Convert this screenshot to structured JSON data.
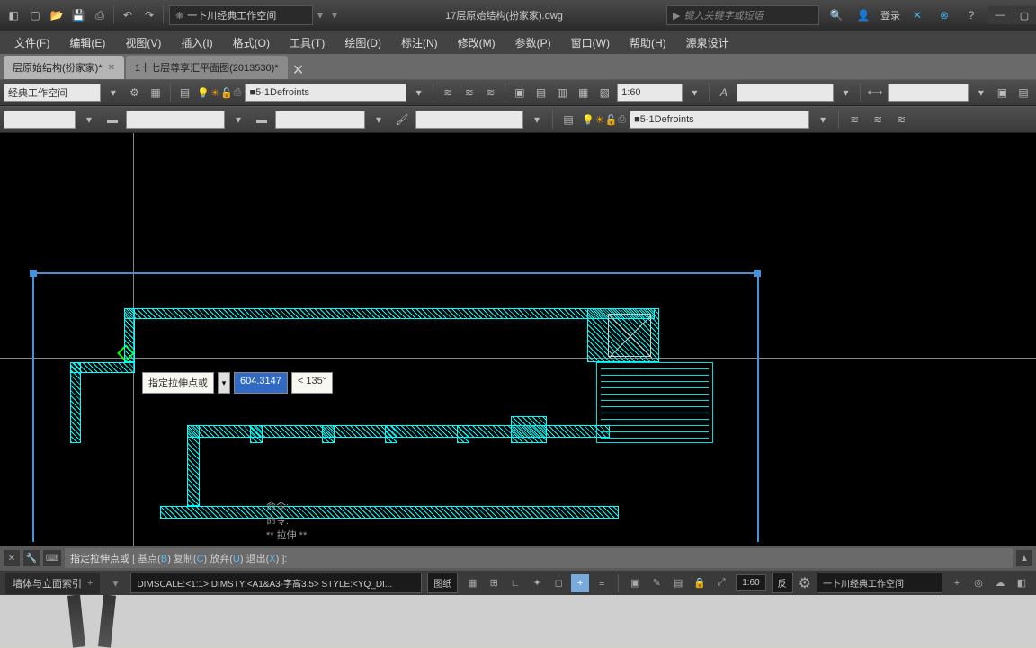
{
  "titlebar": {
    "workspace": "一卜川经典工作空间",
    "filename": "17层原始结构(扮家家).dwg",
    "searchPlaceholder": "键入关键字或短语",
    "login": "登录"
  },
  "menus": [
    "文件(F)",
    "编辑(E)",
    "视图(V)",
    "插入(I)",
    "格式(O)",
    "工具(T)",
    "绘图(D)",
    "标注(N)",
    "修改(M)",
    "参数(P)",
    "窗口(W)",
    "帮助(H)",
    "源泉设计"
  ],
  "tabs": [
    {
      "label": "层原始结构(扮家家)*",
      "active": true
    },
    {
      "label": "1十七层尊享汇平面图(2013530)*",
      "active": false
    }
  ],
  "toolbars": {
    "row1": {
      "workspace_cb": "经典工作空间",
      "layer_cb": "5-1Defroints",
      "scale": "1:60"
    },
    "row2": {
      "layer_cb2": "5-1Defroints"
    }
  },
  "dynInput": {
    "prompt": "指定拉伸点或",
    "value": "604.3147",
    "angle": "< 135°"
  },
  "cmdHistory": {
    "l1": "命令:",
    "l2": "命令:",
    "l3": "** 拉伸 **"
  },
  "cmdline": {
    "prefix": "指定拉伸点或",
    "opts": "[ 基点(",
    "k1": "B",
    "o2": ")  复制(",
    "k2": "C",
    "o3": ")  放弃(",
    "k3": "U",
    "o4": ")  退出(",
    "k4": "X",
    "o5": ") ]:"
  },
  "status": {
    "wallidx": "墙体与立面索引",
    "dimscale": "DIMSCALE:<1:1> DIMSTY:<A1&A3-字高3.5> STYLE:<YQ_DI...",
    "tuzhi": "图纸",
    "scale2": "1:60",
    "fan": "反",
    "ws2": "一卜川经典工作空间"
  }
}
